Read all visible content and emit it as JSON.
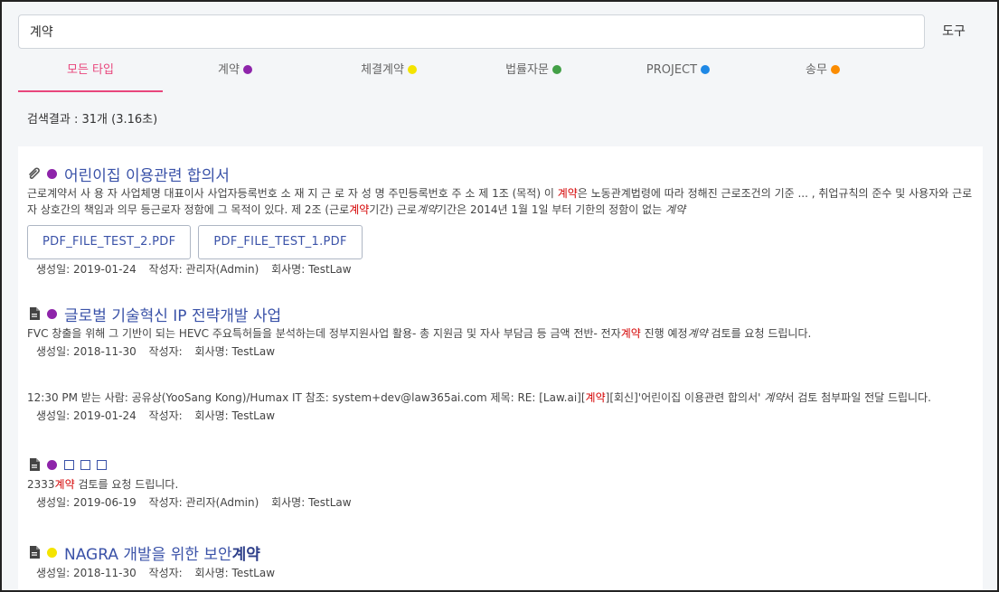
{
  "search": {
    "value": "계약",
    "tool_label": "도구"
  },
  "tabs": [
    {
      "label": "모든 타입",
      "color": ""
    },
    {
      "label": "계약",
      "color": "#8e24aa"
    },
    {
      "label": "체결계약",
      "color": "#f4e400"
    },
    {
      "label": "법률자문",
      "color": "#43a047"
    },
    {
      "label": "PROJECT",
      "color": "#1e88e5"
    },
    {
      "label": "송무",
      "color": "#fb8c00"
    }
  ],
  "result_count": "검색결과 : 31개 (3.16초)",
  "colors": {
    "purple": "#8e24aa",
    "yellow": "#f4e400",
    "accent": "#e8467c",
    "link": "#3a52a8",
    "highlight": "#d40000"
  },
  "results": [
    {
      "icon": "paperclip-icon",
      "title": "어린이집 이용관련 합의서",
      "snippet": {
        "p1": "근로계약서 사 용 자 사업체명 대표이사 사업자등록번호 소 재 지 근 로 자 성 명 주민등록번호 주 소 제 1조 (목적) 이 ",
        "h1": "계약",
        "p2": "은 노동관계법령에 따라 정해진 근로조건의 기준 ... , 취업규칙의 준수 및 사용자와 근로자 상호간의 책임과 의무 등근로자 정함에 그 목적이 있다. 제 2조 (근로",
        "h2": "계약",
        "p3": "기간) 근로",
        "i1": "계약",
        "p4": "기간은 2014년 1월 1일 부터 기한의 정함이 없는 ",
        "i2": "계약"
      },
      "files": [
        "PDF_FILE_TEST_2.PDF",
        "PDF_FILE_TEST_1.PDF"
      ],
      "meta": {
        "created": "생성일: 2019-01-24",
        "author": "작성자: 관리자(Admin)",
        "company": "회사명: TestLaw"
      }
    },
    {
      "icon": "document-icon",
      "title": "글로벌 기술혁신 IP 전략개발 사업",
      "snippet": {
        "p1": "FVC 창출을 위해 그 기반이 되는 HEVC 주요특허들을 분석하는데 정부지원사업 활용- 총 지원금 및 자사 부담금 등 금액 전반- 전자",
        "h1": "계약",
        "p2": " 진행 예정",
        "i1": "계약",
        "p3": " 검토를 요청 드립니다."
      },
      "meta": {
        "created": "생성일: 2018-11-30",
        "author": "작성자:",
        "company": "회사명: TestLaw"
      }
    },
    {
      "snippet": {
        "p1": "12:30 PM 받는 사람: 공유상(YooSang Kong)/Humax IT 참조: system+dev@law365ai.com 제목: RE: [Law.ai][",
        "h1": "계약",
        "p2": "][회신]'어린이집 이용관련 합의서' ",
        "i1": "계약",
        "p3": "서 검토 첨부파일 전달 드립니다."
      },
      "meta": {
        "created": "생성일: 2019-01-24",
        "author": "작성자:",
        "company": "회사명: TestLaw"
      }
    },
    {
      "icon": "document-icon",
      "title": "",
      "snippet": {
        "p1": "2333",
        "h1": "계약",
        "p2": " 검토를 요청 드립니다."
      },
      "meta": {
        "created": "생성일: 2019-06-19",
        "author": "작성자: 관리자(Admin)",
        "company": "회사명: TestLaw"
      }
    },
    {
      "icon": "document-icon",
      "title_pre": "NAGRA 개발을 위한 보안",
      "title_bold": "계약",
      "meta": {
        "created": "생성일: 2018-11-30",
        "author": "작성자:",
        "company": "회사명: TestLaw"
      }
    }
  ]
}
